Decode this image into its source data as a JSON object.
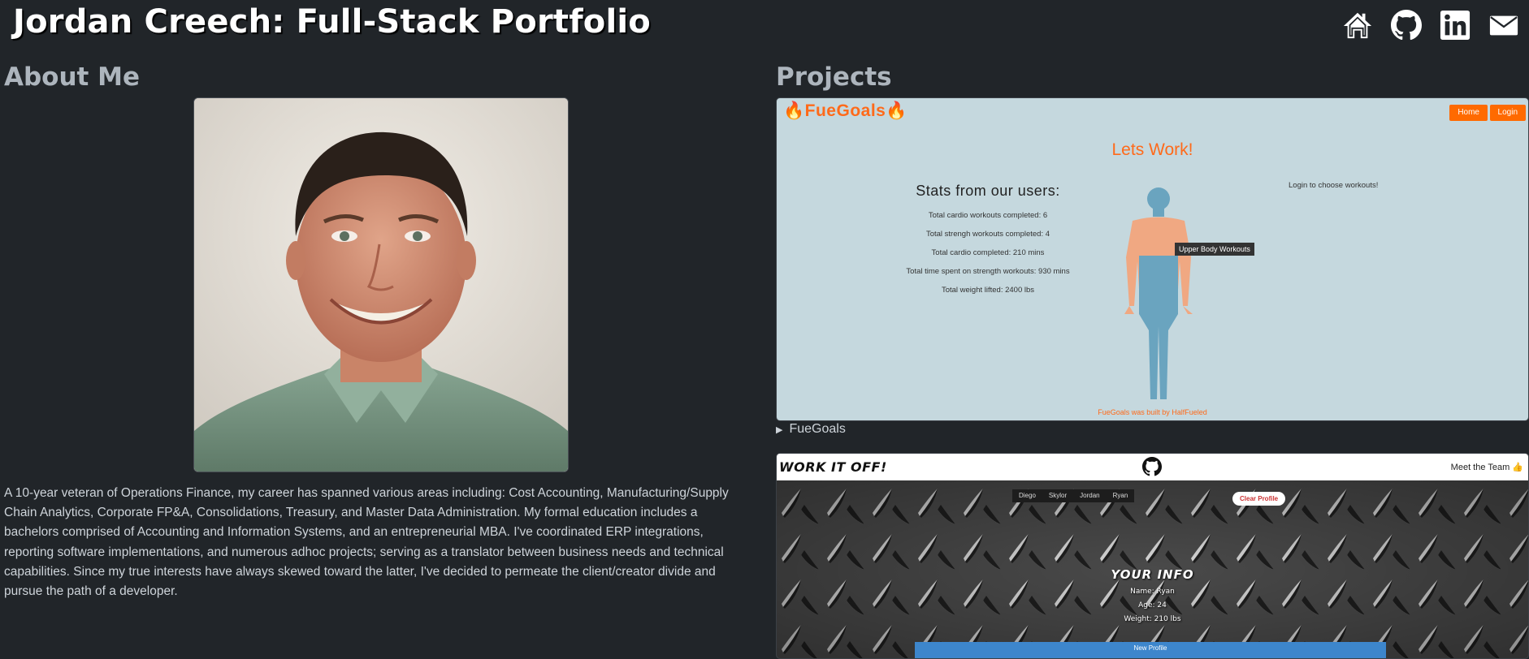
{
  "header": {
    "title": "Jordan Creech: Full-Stack Portfolio",
    "icons": [
      "home-icon",
      "github-icon",
      "linkedin-icon",
      "mail-icon"
    ]
  },
  "about": {
    "heading": "About Me",
    "text": "A 10-year veteran of Operations Finance, my career has spanned various areas including: Cost Accounting, Manufacturing/Supply Chain Analytics, Corporate FP&A, Consolidations, Treasury, and Master Data Administration. My formal education includes a bachelors comprised of Accounting and Information Systems, and an entrepreneurial MBA. I've coordinated ERP integrations, reporting software implementations, and numerous adhoc projects; serving as a translator between business needs and technical capabilities. Since my true interests have always skewed toward the latter, I've decided to permeate the client/creator divide and pursue the path of a developer."
  },
  "projects": {
    "heading": "Projects",
    "items": [
      {
        "summary": "FueGoals",
        "screenshot": {
          "logo": "FueGoals",
          "home": "Home",
          "login": "Login",
          "headline": "Lets Work!",
          "stats_title": "Stats from our users:",
          "stats": [
            "Total cardio workouts completed: 6",
            "Total strengh workouts completed: 4",
            "Total cardio completed: 210 mins",
            "Total time spent on strength workouts: 930 mins",
            "Total weight lifted: 2400 lbs"
          ],
          "login_note": "Login to choose workouts!",
          "tooltip": "Upper Body Workouts",
          "footer": "FueGoals was built by HalfFueled"
        }
      },
      {
        "screenshot": {
          "logo": "WORK IT OFF!",
          "team": "Meet the Team",
          "names": [
            "Diego",
            "Skylor",
            "Jordan",
            "Ryan"
          ],
          "clear": "Clear Profile",
          "info_title": "YOUR INFO",
          "name_line": "Name: Ryan",
          "age_line": "Age: 24",
          "weight_line": "Weight: 210 lbs",
          "new_profile": "New Profile"
        }
      }
    ]
  },
  "colors": {
    "background": "#212529",
    "accent_orange": "#ff6a1a",
    "text": "#ced4da"
  }
}
